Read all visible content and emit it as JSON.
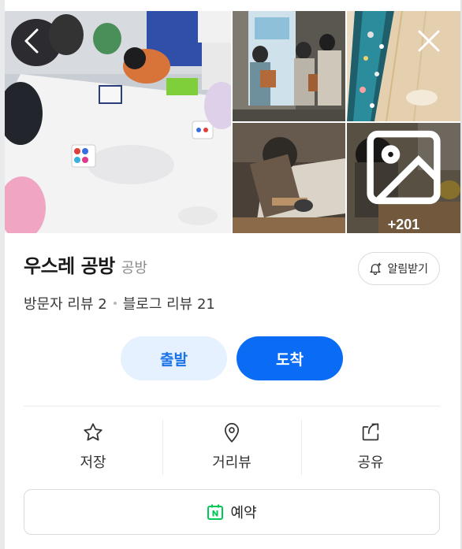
{
  "gallery": {
    "more_count": "+201",
    "icons": {
      "back": "chevron-left-icon",
      "close": "close-icon",
      "photo": "image-icon"
    }
  },
  "place": {
    "name": "우스레 공방",
    "category": "공방"
  },
  "alarm": {
    "label": "알림받기",
    "icon": "bell-plus-icon"
  },
  "reviews": {
    "visitor": "방문자 리뷰 2",
    "blog": "블로그 리뷰 21"
  },
  "route": {
    "depart_label": "출발",
    "arrive_label": "도착"
  },
  "actions": [
    {
      "label": "저장",
      "icon": "star-icon"
    },
    {
      "label": "거리뷰",
      "icon": "map-pin-icon"
    },
    {
      "label": "공유",
      "icon": "share-icon"
    }
  ],
  "reserve": {
    "label": "예약",
    "icon": "naver-calendar-icon"
  },
  "colors": {
    "primary": "#0a6cf5",
    "primary_light": "#e6f1ff",
    "primary_text": "#1972e8",
    "naver_green": "#03c75a"
  }
}
